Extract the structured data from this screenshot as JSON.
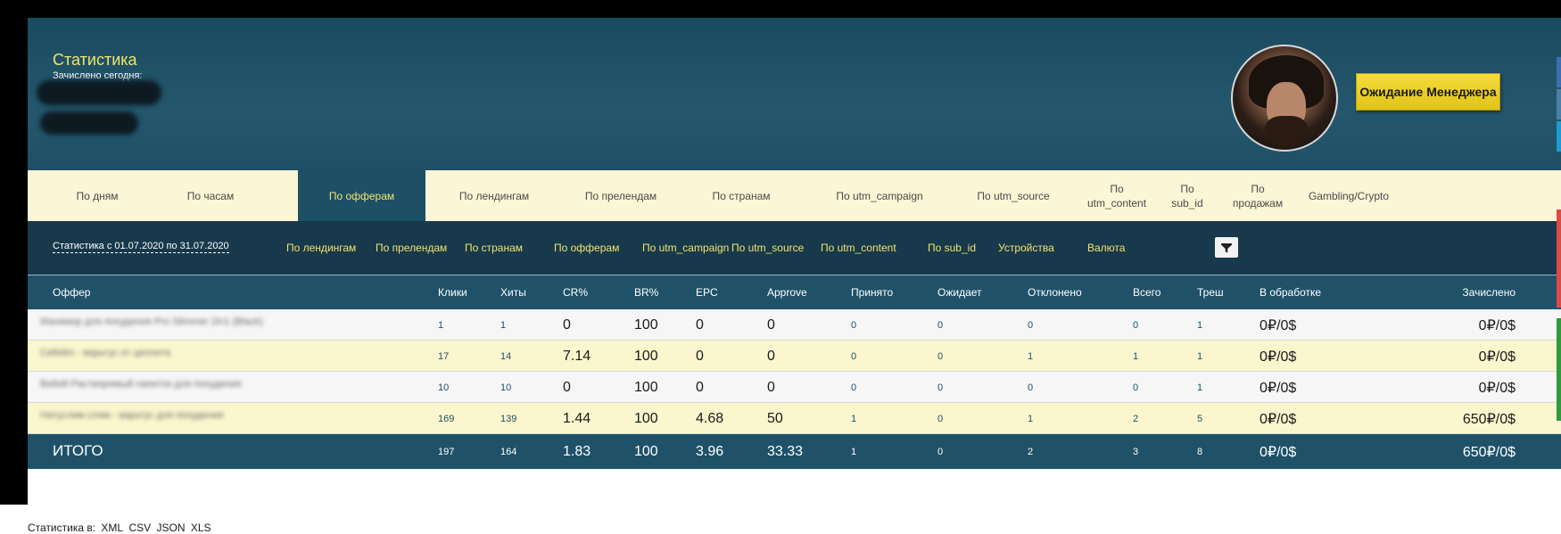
{
  "header": {
    "title": "Статистика",
    "subtitle": "Зачислено сегодня:",
    "manager_button": "Ожидание Менеджера"
  },
  "tabs": [
    {
      "label": "По дням"
    },
    {
      "label": "По часам"
    },
    {
      "label": "По офферам"
    },
    {
      "label": "По лендингам"
    },
    {
      "label": "По прелендам"
    },
    {
      "label": "По странам"
    },
    {
      "label": "По utm_campaign"
    },
    {
      "label": "По utm_source"
    },
    {
      "label": "По utm_content"
    },
    {
      "label": "По sub_id"
    },
    {
      "label": "По продажам"
    },
    {
      "label": "Gambling/Crypto"
    }
  ],
  "filters": {
    "period": "Статистика с 01.07.2020 по 31.07.2020",
    "links": [
      "По лендингам",
      "По прелендам",
      "По странам",
      "По офферам",
      "По utm_campaign",
      "По utm_source",
      "По utm_content",
      "По sub_id",
      "Устройства",
      "Валюта"
    ]
  },
  "table": {
    "headers": [
      "Оффер",
      "Клики",
      "Хиты",
      "CR%",
      "BR%",
      "EPC",
      "Approve",
      "Принято",
      "Ожидает",
      "Отклонено",
      "Всего",
      "Треш",
      "В обработке",
      "Зачислено"
    ],
    "rows": [
      {
        "offer": "Маникюр для похудения Pro Slimmer 2in1 (Black)",
        "cells": [
          "1",
          "1",
          "0",
          "100",
          "0",
          "0",
          "0",
          "0",
          "0",
          "0",
          "1",
          "0₽/0$",
          "0₽/0$"
        ]
      },
      {
        "offer": "Cellslim - варьтус от целлита",
        "cells": [
          "17",
          "14",
          "7.14",
          "100",
          "0",
          "0",
          "0",
          "0",
          "1",
          "1",
          "1",
          "0₽/0$",
          "0₽/0$"
        ]
      },
      {
        "offer": "Beltslil Растворимый напиток для похудения",
        "cells": [
          "10",
          "10",
          "0",
          "100",
          "0",
          "0",
          "0",
          "0",
          "0",
          "0",
          "1",
          "0₽/0$",
          "0₽/0$"
        ]
      },
      {
        "offer": "Натуслим слим - варьтус для похудения",
        "cells": [
          "169",
          "139",
          "1.44",
          "100",
          "4.68",
          "50",
          "1",
          "0",
          "1",
          "2",
          "5",
          "0₽/0$",
          "650₽/0$"
        ]
      }
    ],
    "total": {
      "label": "ИТОГО",
      "cells": [
        "197",
        "164",
        "1.83",
        "100",
        "3.96",
        "33.33",
        "1",
        "0",
        "2",
        "3",
        "8",
        "0₽/0$",
        "650₽/0$"
      ]
    }
  },
  "export": {
    "prefix": "Статистика в:",
    "formats": [
      "XML",
      "CSV",
      "JSON",
      "XLS"
    ]
  },
  "colors": {
    "header_bg": "#1f5269",
    "accent_yellow": "#f2e36a",
    "tab_bg": "#fbf6d6",
    "button_yellow": "#e9cc25"
  }
}
